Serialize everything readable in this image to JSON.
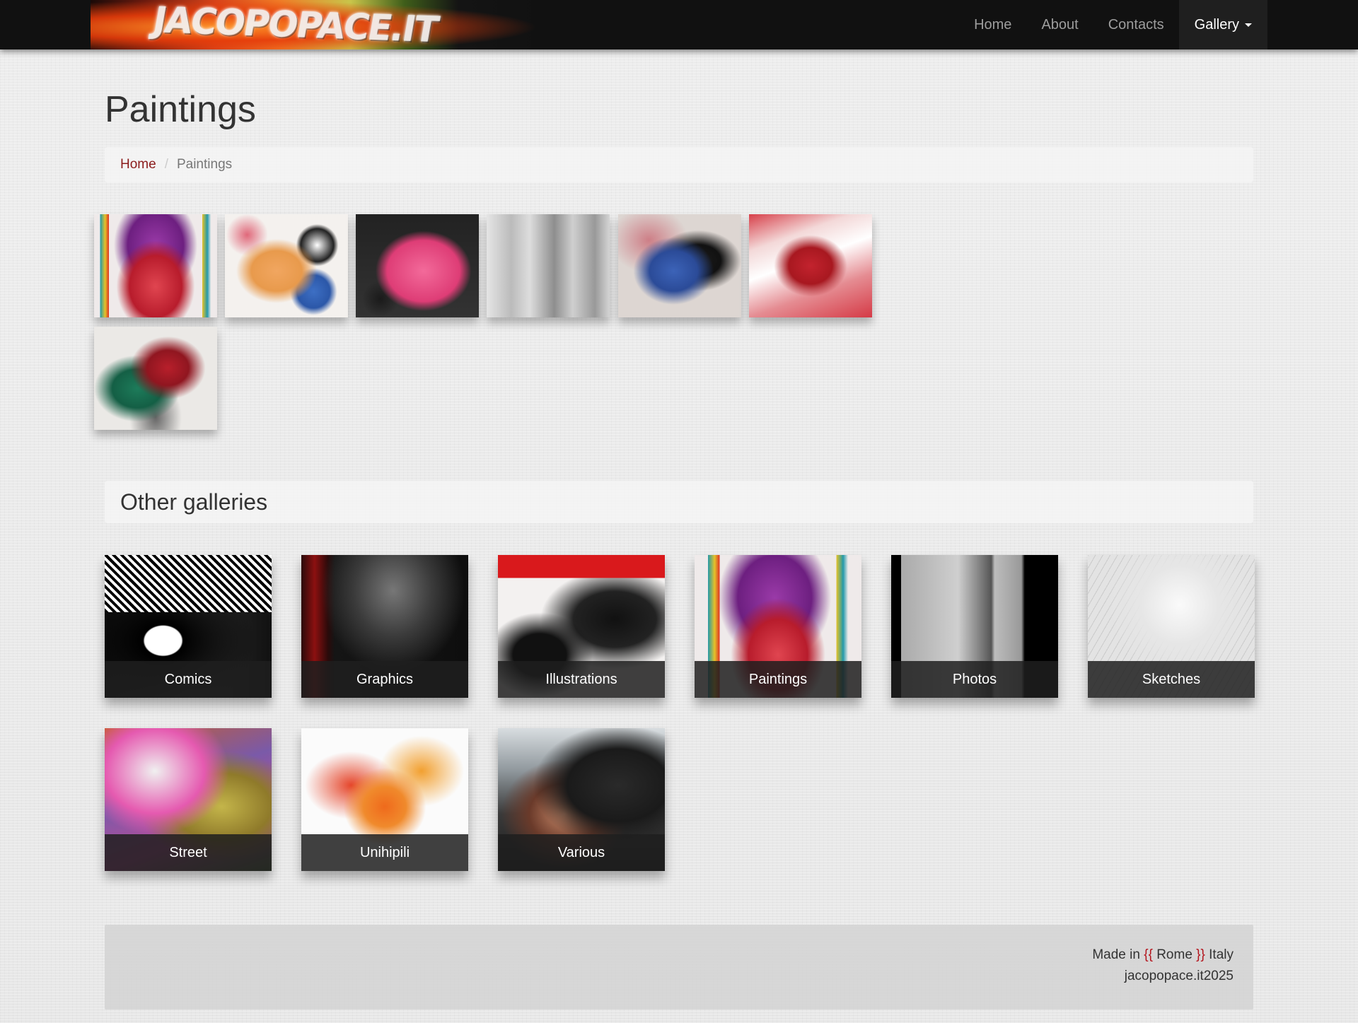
{
  "navbar": {
    "brand_text": "JACOPOPACE.IT",
    "links": [
      {
        "label": "Home"
      },
      {
        "label": "About"
      },
      {
        "label": "Contacts"
      },
      {
        "label": "Gallery"
      }
    ]
  },
  "page": {
    "title": "Paintings"
  },
  "breadcrumb": {
    "home": "Home",
    "separator": "/",
    "current": "Paintings"
  },
  "thumbnails": [
    "painting-1",
    "painting-2",
    "painting-3",
    "painting-4",
    "painting-5",
    "painting-6",
    "painting-7"
  ],
  "other_galleries": {
    "title": "Other galleries",
    "items": [
      {
        "label": "Comics"
      },
      {
        "label": "Graphics"
      },
      {
        "label": "Illustrations"
      },
      {
        "label": "Paintings"
      },
      {
        "label": "Photos"
      },
      {
        "label": "Sketches"
      },
      {
        "label": "Street"
      },
      {
        "label": "Unihipili"
      },
      {
        "label": "Various"
      }
    ]
  },
  "footer": {
    "made_in_prefix": "Made in ",
    "brace_open": "{{",
    "city": " Rome ",
    "brace_close": "}}",
    "country": " Italy",
    "copyright": "jacopopace.it2025"
  },
  "colors": {
    "navbar_bg": "#111111",
    "accent_red": "#8b1c1c",
    "brace_red": "#b3141c"
  }
}
